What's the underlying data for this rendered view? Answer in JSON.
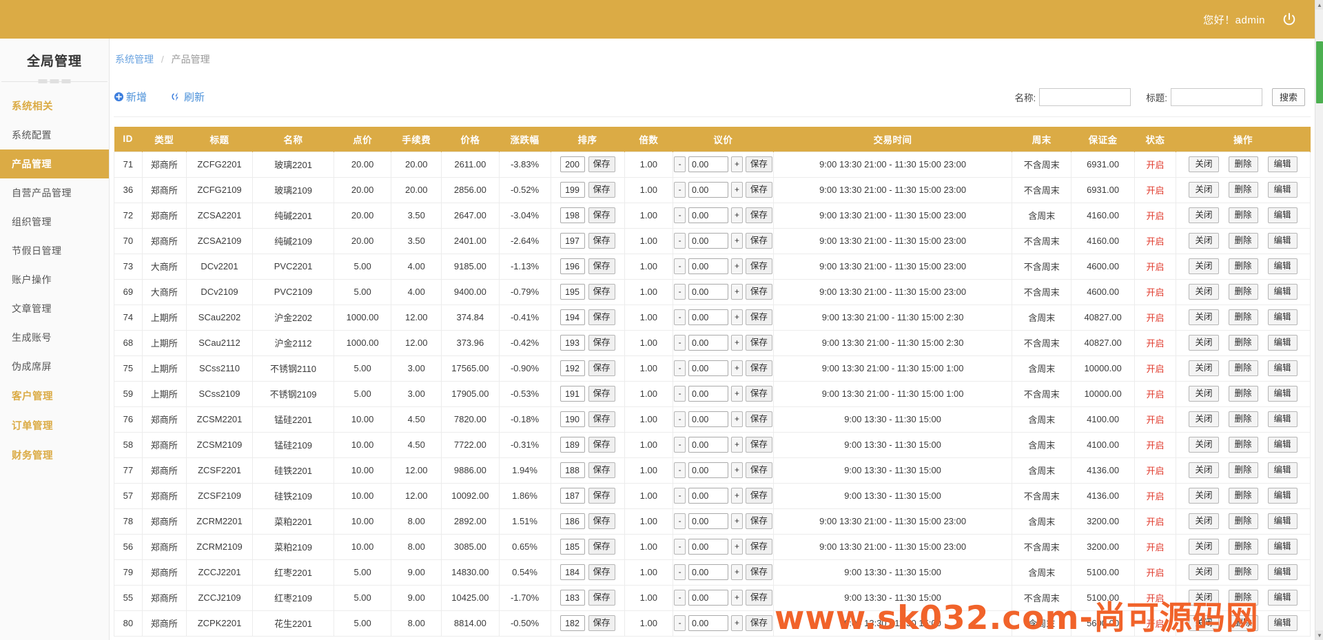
{
  "topbar": {
    "greeting": "您好！admin",
    "power_icon": "power-icon"
  },
  "sidebar": {
    "brand": "全局管理",
    "groups": [
      {
        "label": "系统相关",
        "items": [
          {
            "label": "系统配置",
            "active": false
          },
          {
            "label": "产品管理",
            "active": true
          },
          {
            "label": "自营产品管理",
            "active": false
          },
          {
            "label": "组织管理",
            "active": false
          },
          {
            "label": "节假日管理",
            "active": false
          },
          {
            "label": "账户操作",
            "active": false
          },
          {
            "label": "文章管理",
            "active": false
          },
          {
            "label": "生成账号",
            "active": false
          },
          {
            "label": "伪成席屏",
            "active": false
          }
        ]
      },
      {
        "label": "客户管理",
        "items": []
      },
      {
        "label": "订单管理",
        "items": []
      },
      {
        "label": "财务管理",
        "items": []
      }
    ]
  },
  "breadcrumb": {
    "root": "系统管理",
    "sep": "/",
    "current": "产品管理"
  },
  "toolbar": {
    "add_label": "新增",
    "add_icon": "plus-circle-icon",
    "refresh_label": "刷新",
    "refresh_icon": "refresh-icon"
  },
  "search": {
    "name_label": "名称:",
    "name_value": "",
    "name_placeholder": "",
    "title_label": "标题:",
    "title_value": "",
    "title_placeholder": "",
    "button_label": "搜索"
  },
  "table": {
    "columns": [
      "ID",
      "类型",
      "标题",
      "名称",
      "点价",
      "手续费",
      "价格",
      "涨跌幅",
      "排序",
      "倍数",
      "议价",
      "交易时间",
      "周末",
      "保证金",
      "状态",
      "操作"
    ],
    "row_buttons": {
      "save": "保存",
      "minus": "-",
      "plus": "+",
      "close": "关闭",
      "delete": "删除",
      "edit": "编辑"
    },
    "rows": [
      {
        "id": "71",
        "type": "郑商所",
        "title": "ZCFG2201",
        "name": "玻璃2201",
        "point": "20.00",
        "fee": "20.00",
        "price": "2611.00",
        "change": "-3.83%",
        "sort": "200",
        "multi": "1.00",
        "bid": "0.00",
        "time": "9:00 13:30 21:00 - 11:30 15:00 23:00",
        "weekend": "不含周末",
        "margin": "6931.00",
        "status": "开启"
      },
      {
        "id": "36",
        "type": "郑商所",
        "title": "ZCFG2109",
        "name": "玻璃2109",
        "point": "20.00",
        "fee": "20.00",
        "price": "2856.00",
        "change": "-0.52%",
        "sort": "199",
        "multi": "1.00",
        "bid": "0.00",
        "time": "9:00 13:30 21:00 - 11:30 15:00 23:00",
        "weekend": "不含周末",
        "margin": "6931.00",
        "status": "开启"
      },
      {
        "id": "72",
        "type": "郑商所",
        "title": "ZCSA2201",
        "name": "纯碱2201",
        "point": "20.00",
        "fee": "3.50",
        "price": "2647.00",
        "change": "-3.04%",
        "sort": "198",
        "multi": "1.00",
        "bid": "0.00",
        "time": "9:00 13:30 21:00 - 11:30 15:00 23:00",
        "weekend": "含周末",
        "margin": "4160.00",
        "status": "开启"
      },
      {
        "id": "70",
        "type": "郑商所",
        "title": "ZCSA2109",
        "name": "纯碱2109",
        "point": "20.00",
        "fee": "3.50",
        "price": "2401.00",
        "change": "-2.64%",
        "sort": "197",
        "multi": "1.00",
        "bid": "0.00",
        "time": "9:00 13:30 21:00 - 11:30 15:00 23:00",
        "weekend": "不含周末",
        "margin": "4160.00",
        "status": "开启"
      },
      {
        "id": "73",
        "type": "大商所",
        "title": "DCv2201",
        "name": "PVC2201",
        "point": "5.00",
        "fee": "4.00",
        "price": "9185.00",
        "change": "-1.13%",
        "sort": "196",
        "multi": "1.00",
        "bid": "0.00",
        "time": "9:00 13:30 21:00 - 11:30 15:00 23:00",
        "weekend": "不含周末",
        "margin": "4600.00",
        "status": "开启"
      },
      {
        "id": "69",
        "type": "大商所",
        "title": "DCv2109",
        "name": "PVC2109",
        "point": "5.00",
        "fee": "4.00",
        "price": "9400.00",
        "change": "-0.79%",
        "sort": "195",
        "multi": "1.00",
        "bid": "0.00",
        "time": "9:00 13:30 21:00 - 11:30 15:00 23:00",
        "weekend": "不含周末",
        "margin": "4600.00",
        "status": "开启"
      },
      {
        "id": "74",
        "type": "上期所",
        "title": "SCau2202",
        "name": "沪金2202",
        "point": "1000.00",
        "fee": "12.00",
        "price": "374.84",
        "change": "-0.41%",
        "sort": "194",
        "multi": "1.00",
        "bid": "0.00",
        "time": "9:00 13:30 21:00 - 11:30 15:00 2:30",
        "weekend": "含周末",
        "margin": "40827.00",
        "status": "开启"
      },
      {
        "id": "68",
        "type": "上期所",
        "title": "SCau2112",
        "name": "沪金2112",
        "point": "1000.00",
        "fee": "12.00",
        "price": "373.96",
        "change": "-0.42%",
        "sort": "193",
        "multi": "1.00",
        "bid": "0.00",
        "time": "9:00 13:30 21:00 - 11:30 15:00 2:30",
        "weekend": "不含周末",
        "margin": "40827.00",
        "status": "开启"
      },
      {
        "id": "75",
        "type": "上期所",
        "title": "SCss2110",
        "name": "不锈钢2110",
        "point": "5.00",
        "fee": "3.00",
        "price": "17565.00",
        "change": "-0.90%",
        "sort": "192",
        "multi": "1.00",
        "bid": "0.00",
        "time": "9:00 13:30 21:00 - 11:30 15:00 1:00",
        "weekend": "含周末",
        "margin": "10000.00",
        "status": "开启"
      },
      {
        "id": "59",
        "type": "上期所",
        "title": "SCss2109",
        "name": "不锈钢2109",
        "point": "5.00",
        "fee": "3.00",
        "price": "17905.00",
        "change": "-0.53%",
        "sort": "191",
        "multi": "1.00",
        "bid": "0.00",
        "time": "9:00 13:30 21:00 - 11:30 15:00 1:00",
        "weekend": "不含周末",
        "margin": "10000.00",
        "status": "开启"
      },
      {
        "id": "76",
        "type": "郑商所",
        "title": "ZCSM2201",
        "name": "锰硅2201",
        "point": "10.00",
        "fee": "4.50",
        "price": "7820.00",
        "change": "-0.18%",
        "sort": "190",
        "multi": "1.00",
        "bid": "0.00",
        "time": "9:00 13:30 - 11:30 15:00",
        "weekend": "含周末",
        "margin": "4100.00",
        "status": "开启"
      },
      {
        "id": "58",
        "type": "郑商所",
        "title": "ZCSM2109",
        "name": "锰硅2109",
        "point": "10.00",
        "fee": "4.50",
        "price": "7722.00",
        "change": "-0.31%",
        "sort": "189",
        "multi": "1.00",
        "bid": "0.00",
        "time": "9:00 13:30 - 11:30 15:00",
        "weekend": "含周末",
        "margin": "4100.00",
        "status": "开启"
      },
      {
        "id": "77",
        "type": "郑商所",
        "title": "ZCSF2201",
        "name": "硅铁2201",
        "point": "10.00",
        "fee": "12.00",
        "price": "9886.00",
        "change": "1.94%",
        "sort": "188",
        "multi": "1.00",
        "bid": "0.00",
        "time": "9:00 13:30 - 11:30 15:00",
        "weekend": "含周末",
        "margin": "4136.00",
        "status": "开启"
      },
      {
        "id": "57",
        "type": "郑商所",
        "title": "ZCSF2109",
        "name": "硅铁2109",
        "point": "10.00",
        "fee": "12.00",
        "price": "10092.00",
        "change": "1.86%",
        "sort": "187",
        "multi": "1.00",
        "bid": "0.00",
        "time": "9:00 13:30 - 11:30 15:00",
        "weekend": "不含周末",
        "margin": "4136.00",
        "status": "开启"
      },
      {
        "id": "78",
        "type": "郑商所",
        "title": "ZCRM2201",
        "name": "菜粕2201",
        "point": "10.00",
        "fee": "8.00",
        "price": "2892.00",
        "change": "1.51%",
        "sort": "186",
        "multi": "1.00",
        "bid": "0.00",
        "time": "9:00 13:30 21:00 - 11:30 15:00 23:00",
        "weekend": "含周末",
        "margin": "3200.00",
        "status": "开启"
      },
      {
        "id": "56",
        "type": "郑商所",
        "title": "ZCRM2109",
        "name": "菜粕2109",
        "point": "10.00",
        "fee": "8.00",
        "price": "3085.00",
        "change": "0.65%",
        "sort": "185",
        "multi": "1.00",
        "bid": "0.00",
        "time": "9:00 13:30 21:00 - 11:30 15:00 23:00",
        "weekend": "不含周末",
        "margin": "3200.00",
        "status": "开启"
      },
      {
        "id": "79",
        "type": "郑商所",
        "title": "ZCCJ2201",
        "name": "红枣2201",
        "point": "5.00",
        "fee": "9.00",
        "price": "14830.00",
        "change": "0.54%",
        "sort": "184",
        "multi": "1.00",
        "bid": "0.00",
        "time": "9:00 13:30 - 11:30 15:00",
        "weekend": "含周末",
        "margin": "5100.00",
        "status": "开启"
      },
      {
        "id": "55",
        "type": "郑商所",
        "title": "ZCCJ2109",
        "name": "红枣2109",
        "point": "5.00",
        "fee": "9.00",
        "price": "10425.00",
        "change": "-1.70%",
        "sort": "183",
        "multi": "1.00",
        "bid": "0.00",
        "time": "9:00 13:30 - 11:30 15:00",
        "weekend": "不含周末",
        "margin": "5100.00",
        "status": "开启"
      },
      {
        "id": "80",
        "type": "郑商所",
        "title": "ZCPK2201",
        "name": "花生2201",
        "point": "5.00",
        "fee": "8.00",
        "price": "8814.00",
        "change": "-0.50%",
        "sort": "182",
        "multi": "1.00",
        "bid": "0.00",
        "time": "9:00 13:30 - 11:30 15:00",
        "weekend": "含周末",
        "margin": "5600.00",
        "status": "开启"
      }
    ]
  },
  "watermark": "www.sk032.com-尚可源码网",
  "colors": {
    "brand_gold": "#dbab45",
    "link_blue": "#6aa3e0",
    "status_red": "#e0392b",
    "watermark_orange": "#f1632a",
    "scroll_green": "#4caf50"
  }
}
